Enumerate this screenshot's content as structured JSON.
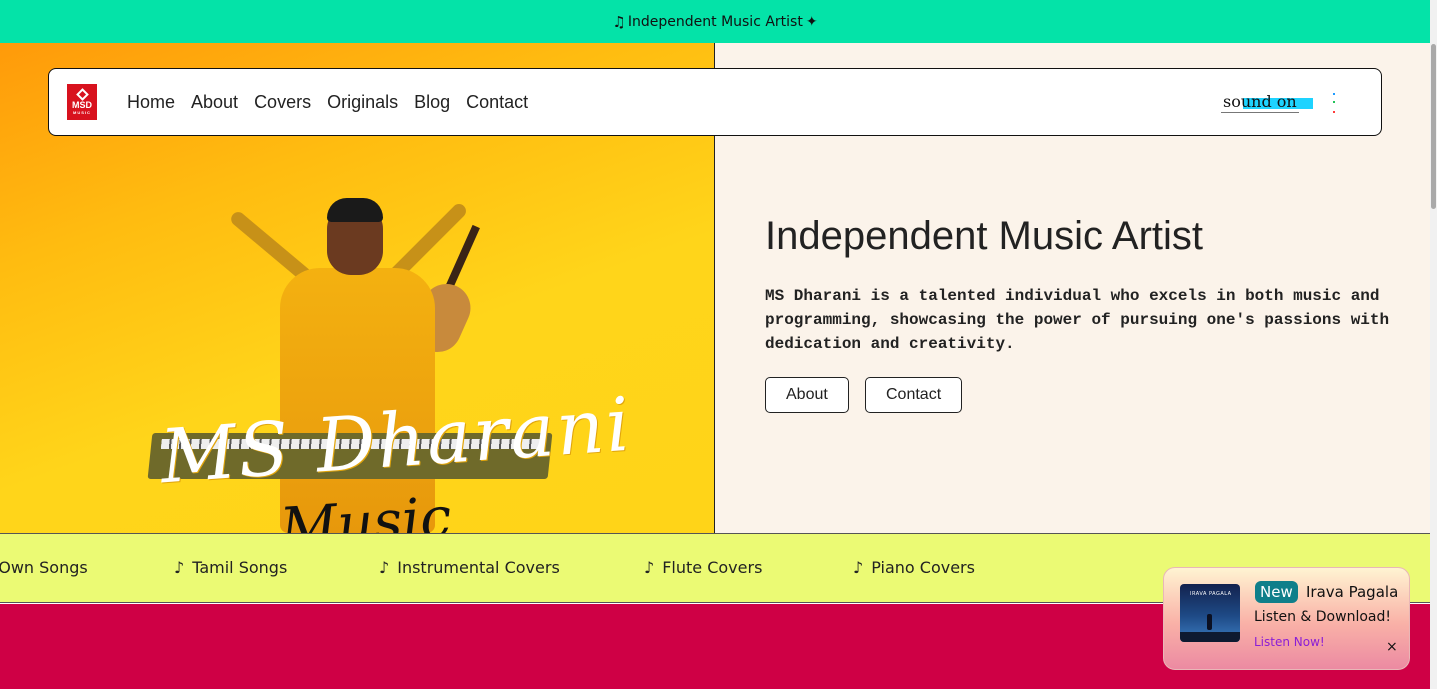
{
  "topbar": {
    "text": "Independent Music Artist",
    "note_icon": "music-note-icon",
    "deco_icon": "sparkle-icon"
  },
  "navbar": {
    "logo": {
      "line1": "MSD",
      "line2": "MUSIC"
    },
    "links": [
      "Home",
      "About",
      "Covers",
      "Originals",
      "Blog",
      "Contact"
    ],
    "sound_toggle": "sound on"
  },
  "hero": {
    "artwork": {
      "name_script": "MS Dharani",
      "music_script": "Music"
    },
    "title": "Independent Music Artist",
    "description": "MS Dharani is a talented individual who excels in both music and programming, showcasing the power of pursuing one's passions with dedication and creativity.",
    "buttons": {
      "about": "About",
      "contact": "Contact"
    }
  },
  "marquee": {
    "items": [
      "Own Songs",
      "Tamil Songs",
      "Instrumental Covers",
      "Flute Covers",
      "Piano Covers"
    ]
  },
  "toast": {
    "badge": "New",
    "song_title": "Irava Pagala",
    "cover_text": "IRAVA PAGALA",
    "subtitle": "Listen & Download!",
    "link": "Listen Now!",
    "close": "×"
  },
  "colors": {
    "topbar": "#04e3a8",
    "marquee": "#ebfa74",
    "bottom_section": "#cf0045",
    "hero_right": "#fbf3ea",
    "logo": "#d8121e"
  }
}
